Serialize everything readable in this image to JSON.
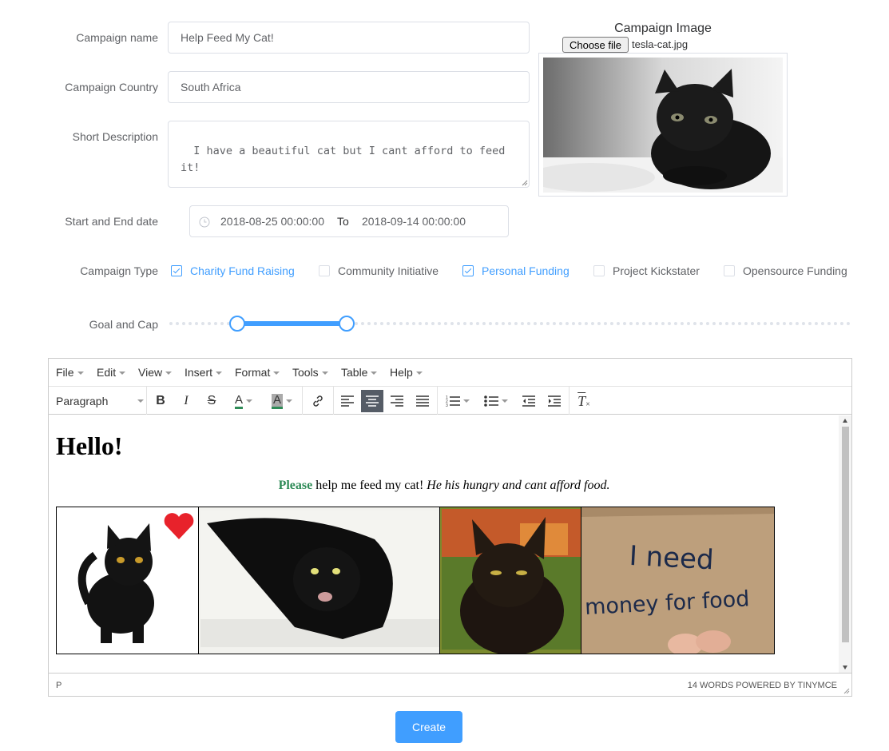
{
  "form": {
    "campaign_name_label": "Campaign name",
    "campaign_name_value": "Help Feed My Cat!",
    "campaign_country_label": "Campaign Country",
    "campaign_country_value": "South Africa",
    "short_description_label": "Short Description",
    "short_description_value": "I have a beautiful cat but I cant afford to feed\nit!",
    "dates_label": "Start and End date",
    "start_date": "2018-08-25 00:00:00",
    "date_separator": "To",
    "end_date": "2018-09-14 00:00:00",
    "campaign_type_label": "Campaign Type",
    "campaign_types": [
      {
        "label": "Charity Fund Raising",
        "checked": true
      },
      {
        "label": "Community Initiative",
        "checked": false
      },
      {
        "label": "Personal Funding",
        "checked": true
      },
      {
        "label": "Project Kickstater",
        "checked": false
      },
      {
        "label": "Opensource Funding",
        "checked": false
      }
    ],
    "goal_cap_label": "Goal and Cap",
    "goal_cap_range": [
      0.1,
      0.26
    ],
    "create_label": "Create"
  },
  "image_upload": {
    "title": "Campaign Image",
    "choose_file_label": "Choose file",
    "file_name": "tesla-cat.jpg"
  },
  "editor": {
    "menu": [
      "File",
      "Edit",
      "View",
      "Insert",
      "Format",
      "Tools",
      "Table",
      "Help"
    ],
    "block_format": "Paragraph",
    "heading": "Hello!",
    "para_bold": "Please",
    "para_plain": " help me feed my cat! ",
    "para_italic": "He his hungry and cant afford food.",
    "sign_line1": "I need",
    "sign_line2": "money for food",
    "status_path": "P",
    "status_right": "14 WORDS POWERED BY TINYMCE"
  },
  "colors": {
    "accent": "#409eff",
    "bold_green": "#2e8b57",
    "heart": "#e8222b"
  }
}
